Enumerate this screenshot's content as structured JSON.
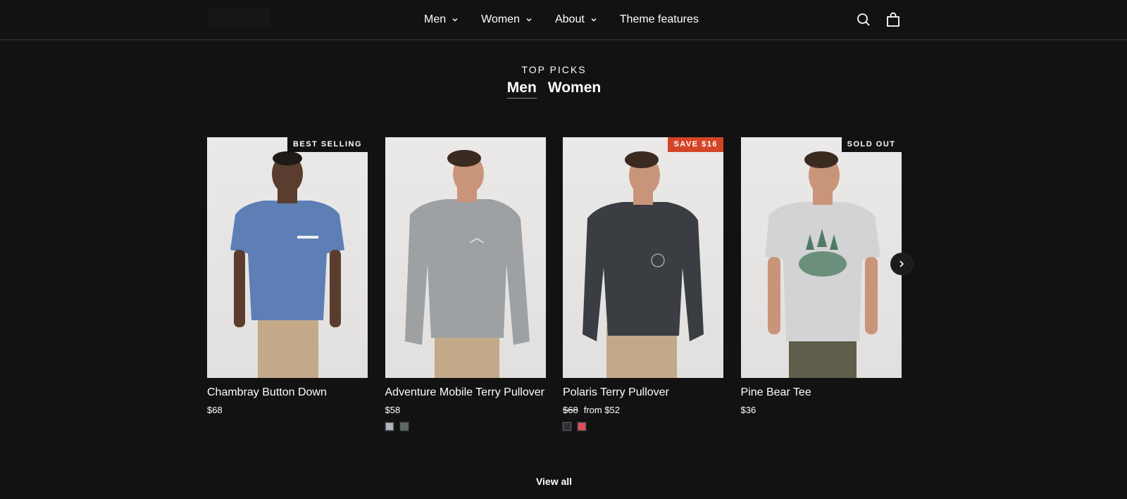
{
  "header": {
    "nav": [
      {
        "label": "Men",
        "has_dropdown": true
      },
      {
        "label": "Women",
        "has_dropdown": true
      },
      {
        "label": "About",
        "has_dropdown": true
      },
      {
        "label": "Theme features",
        "has_dropdown": false
      }
    ],
    "icons": [
      "search-icon",
      "cart-icon"
    ]
  },
  "section": {
    "eyebrow": "TOP PICKS",
    "tabs": [
      {
        "label": "Men",
        "active": true
      },
      {
        "label": "Women",
        "active": false
      }
    ],
    "view_all": "View all"
  },
  "products": [
    {
      "title": "Chambray Button Down",
      "price": "$68",
      "compare_price": "",
      "badge": "BEST SELLING",
      "badge_style": "dark",
      "shirt_color": "#5d7fb6",
      "pants_color": "#c3a988",
      "swatches": []
    },
    {
      "title": "Adventure Mobile Terry Pullover",
      "price": "$58",
      "compare_price": "",
      "badge": "",
      "badge_style": "",
      "shirt_color": "#9da1a4",
      "pants_color": "#c3a988",
      "swatches": [
        "#aeb5c0",
        "#5b6d62"
      ]
    },
    {
      "title": "Polaris Terry Pullover",
      "price": "from $52",
      "compare_price": "$68",
      "badge": "SAVE $16",
      "badge_style": "sale",
      "shirt_color": "#3a3d42",
      "pants_color": "#c3a988",
      "swatches": [
        "#2d3036",
        "#e44a5a"
      ]
    },
    {
      "title": "Pine Bear Tee",
      "price": "$36",
      "compare_price": "",
      "badge": "SOLD OUT",
      "badge_style": "dark",
      "shirt_color": "#d3d3d5",
      "pants_color": "#5f5e4a",
      "swatches": []
    }
  ],
  "colors": {
    "background": "#121212",
    "sale": "#d44527"
  }
}
